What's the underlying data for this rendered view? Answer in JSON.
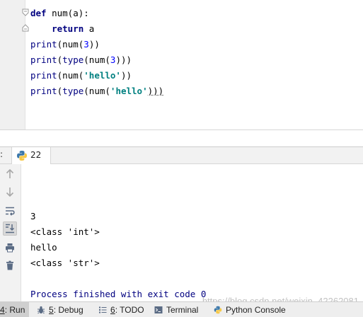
{
  "editor": {
    "lines": [
      {
        "parts": [
          {
            "t": "def",
            "c": "kw"
          },
          {
            "t": " num(a):",
            "c": ""
          }
        ]
      },
      {
        "parts": [
          {
            "t": "    ",
            "c": ""
          },
          {
            "t": "return",
            "c": "kw"
          },
          {
            "t": " a",
            "c": ""
          }
        ]
      },
      {
        "parts": [
          {
            "t": "print",
            "c": "bi"
          },
          {
            "t": "(num(",
            "c": ""
          },
          {
            "t": "3",
            "c": "num"
          },
          {
            "t": "))",
            "c": ""
          }
        ]
      },
      {
        "parts": [
          {
            "t": "print",
            "c": "bi"
          },
          {
            "t": "(",
            "c": ""
          },
          {
            "t": "type",
            "c": "bi"
          },
          {
            "t": "(num(",
            "c": ""
          },
          {
            "t": "3",
            "c": "num"
          },
          {
            "t": ")))",
            "c": ""
          }
        ]
      },
      {
        "parts": [
          {
            "t": "print",
            "c": "bi"
          },
          {
            "t": "(num(",
            "c": ""
          },
          {
            "t": "'hello'",
            "c": "str"
          },
          {
            "t": "))",
            "c": ""
          }
        ]
      },
      {
        "parts": [
          {
            "t": "print",
            "c": "bi"
          },
          {
            "t": "(",
            "c": ""
          },
          {
            "t": "type",
            "c": "bi"
          },
          {
            "t": "(num(",
            "c": ""
          },
          {
            "t": "'hello'",
            "c": "str"
          },
          {
            "t": ")))",
            "c": "underline"
          }
        ]
      }
    ]
  },
  "run_window": {
    "header_prefix": ":",
    "tab_label": "22",
    "tab_icon": "python-icon",
    "toolbar_icons": [
      "arrow-up-icon",
      "arrow-down-icon",
      "soft-wrap-icon",
      "scroll-to-end-icon",
      "print-icon",
      "trash-icon"
    ]
  },
  "console": {
    "lines": [
      "",
      "3",
      "<class 'int'>",
      "hello",
      "<class 'str'>",
      ""
    ],
    "exit_message": "Process finished with exit code 0"
  },
  "watermark": "https://blog.csdn.net/weixin_42262081",
  "statusbar": {
    "run": {
      "key": "4",
      "label": ": Run"
    },
    "debug": {
      "key": "5",
      "label": ": Debug"
    },
    "todo": {
      "key": "6",
      "label": ": TODO"
    },
    "terminal": {
      "label": "Terminal"
    },
    "python_console": {
      "label": "Python Console"
    }
  }
}
